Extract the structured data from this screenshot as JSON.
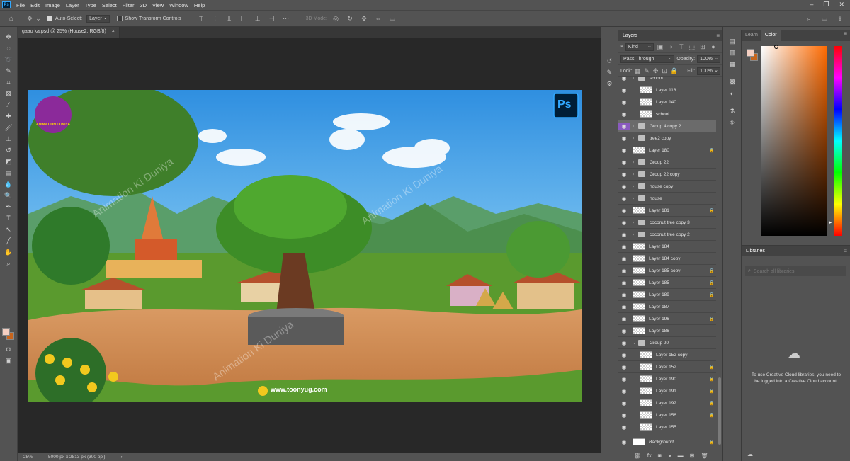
{
  "menubar": {
    "logo": "Ps",
    "items": [
      "File",
      "Edit",
      "Image",
      "Layer",
      "Type",
      "Select",
      "Filter",
      "3D",
      "View",
      "Window",
      "Help"
    ]
  },
  "options": {
    "auto_select_label": "Auto-Select:",
    "auto_select_value": "Layer",
    "show_transform_label": "Show Transform Controls",
    "mode_3d_label": "3D Mode:"
  },
  "document": {
    "tab_title": "gaao ka.psd @ 25% (House2, RGB/8)",
    "tab_close": "×",
    "zoom": "25%",
    "size_info": "5000 px x 2813 px (300 ppi)"
  },
  "canvas": {
    "watermark": "Animation Ki Duniya",
    "website": "www.toonyug.com",
    "badge": "Ps",
    "logo_text": "ANIMATION DUNIYA"
  },
  "layers_panel": {
    "title": "Layers",
    "filter_kind": "Kind",
    "blend_mode": "Pass Through",
    "opacity_label": "Opacity:",
    "opacity_value": "100%",
    "lock_label": "Lock:",
    "fill_label": "Fill:",
    "fill_value": "100%",
    "rows": [
      {
        "name": "school",
        "type": "partial",
        "indent": 1
      },
      {
        "name": "Layer 118",
        "type": "layer",
        "indent": 2
      },
      {
        "name": "Layer 140",
        "type": "layer",
        "indent": 2
      },
      {
        "name": "school",
        "type": "layer",
        "indent": 2
      },
      {
        "name": "Group 4 copy 2",
        "type": "group",
        "indent": 1,
        "selected": true
      },
      {
        "name": "tree2 copy",
        "type": "group",
        "indent": 1
      },
      {
        "name": "Layer 180",
        "type": "layer",
        "indent": 1,
        "lock": true
      },
      {
        "name": "Group 22",
        "type": "group",
        "indent": 1
      },
      {
        "name": "Group 22 copy",
        "type": "group",
        "indent": 1
      },
      {
        "name": "house copy",
        "type": "group",
        "indent": 1
      },
      {
        "name": "house",
        "type": "group",
        "indent": 1
      },
      {
        "name": "Layer 181",
        "type": "layer",
        "indent": 1,
        "lock": true
      },
      {
        "name": "coconut tree copy 3",
        "type": "group",
        "indent": 1
      },
      {
        "name": "coconut tree copy 2",
        "type": "group",
        "indent": 1
      },
      {
        "name": "Layer 184",
        "type": "layer",
        "indent": 1
      },
      {
        "name": "Layer 184 copy",
        "type": "layer",
        "indent": 1
      },
      {
        "name": "Layer 185 copy",
        "type": "layer",
        "indent": 1,
        "lock": true
      },
      {
        "name": "Layer 185",
        "type": "layer",
        "indent": 1,
        "lock": true
      },
      {
        "name": "Layer 189",
        "type": "layer",
        "indent": 1,
        "lock": true
      },
      {
        "name": "Layer 187",
        "type": "layer",
        "indent": 1
      },
      {
        "name": "Layer 196",
        "type": "layer",
        "indent": 1,
        "lock": true
      },
      {
        "name": "Layer 186",
        "type": "layer",
        "indent": 1
      },
      {
        "name": "Group 20",
        "type": "group-open",
        "indent": 1
      },
      {
        "name": "Layer 152 copy",
        "type": "layer",
        "indent": 2
      },
      {
        "name": "Layer 152",
        "type": "layer",
        "indent": 2,
        "lock": true
      },
      {
        "name": "Layer 190",
        "type": "layer",
        "indent": 2,
        "lock": true
      },
      {
        "name": "Layer 191",
        "type": "layer",
        "indent": 2,
        "lock": true
      },
      {
        "name": "Layer 192",
        "type": "layer",
        "indent": 2,
        "lock": true
      },
      {
        "name": "Layer 156",
        "type": "layer",
        "indent": 2,
        "lock": true
      },
      {
        "name": "Layer 155",
        "type": "layer",
        "indent": 2
      }
    ],
    "background_layer": "Background"
  },
  "color_panel": {
    "tab_learn": "Learn",
    "tab_color": "Color",
    "fg": "#f4cfc2",
    "bg": "#c6641c"
  },
  "libraries": {
    "title": "Libraries",
    "search_placeholder": "Search all libraries",
    "message": "To use Creative Cloud libraries, you need to be logged into a Creative Cloud account."
  }
}
